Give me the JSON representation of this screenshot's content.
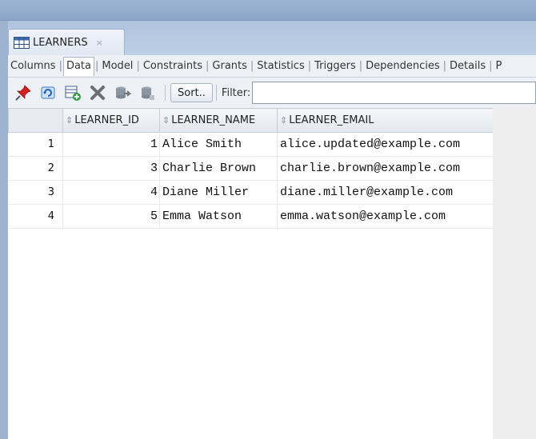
{
  "tab": {
    "title": "LEARNERS",
    "close_glyph": "×",
    "icon": "table-grid-icon"
  },
  "subtabs": [
    {
      "label": "Columns",
      "active": false
    },
    {
      "label": "Data",
      "active": true
    },
    {
      "label": "Model",
      "active": false
    },
    {
      "label": "Constraints",
      "active": false
    },
    {
      "label": "Grants",
      "active": false
    },
    {
      "label": "Statistics",
      "active": false
    },
    {
      "label": "Triggers",
      "active": false
    },
    {
      "label": "Dependencies",
      "active": false
    },
    {
      "label": "Details",
      "active": false
    },
    {
      "label": "P",
      "active": false
    }
  ],
  "toolbar": {
    "icons": [
      "pin-icon",
      "refresh-icon",
      "insert-row-icon",
      "delete-row-icon",
      "commit-icon",
      "rollback-icon"
    ],
    "sort_label": "Sort..",
    "filter_label": "Filter:",
    "filter_value": ""
  },
  "grid": {
    "columns": [
      "LEARNER_ID",
      "LEARNER_NAME",
      "LEARNER_EMAIL"
    ],
    "rows": [
      {
        "rownum": "1",
        "id": "1",
        "name": "Alice Smith",
        "email": "alice.updated@example.com"
      },
      {
        "rownum": "2",
        "id": "3",
        "name": "Charlie Brown",
        "email": "charlie.brown@example.com"
      },
      {
        "rownum": "3",
        "id": "4",
        "name": "Diane Miller",
        "email": "diane.miller@example.com"
      },
      {
        "rownum": "4",
        "id": "5",
        "name": "Emma Watson",
        "email": "emma.watson@example.com"
      }
    ]
  },
  "colors": {
    "accent": "#8fa8c8",
    "pin": "#d42020",
    "delete": "#6a6f76"
  }
}
